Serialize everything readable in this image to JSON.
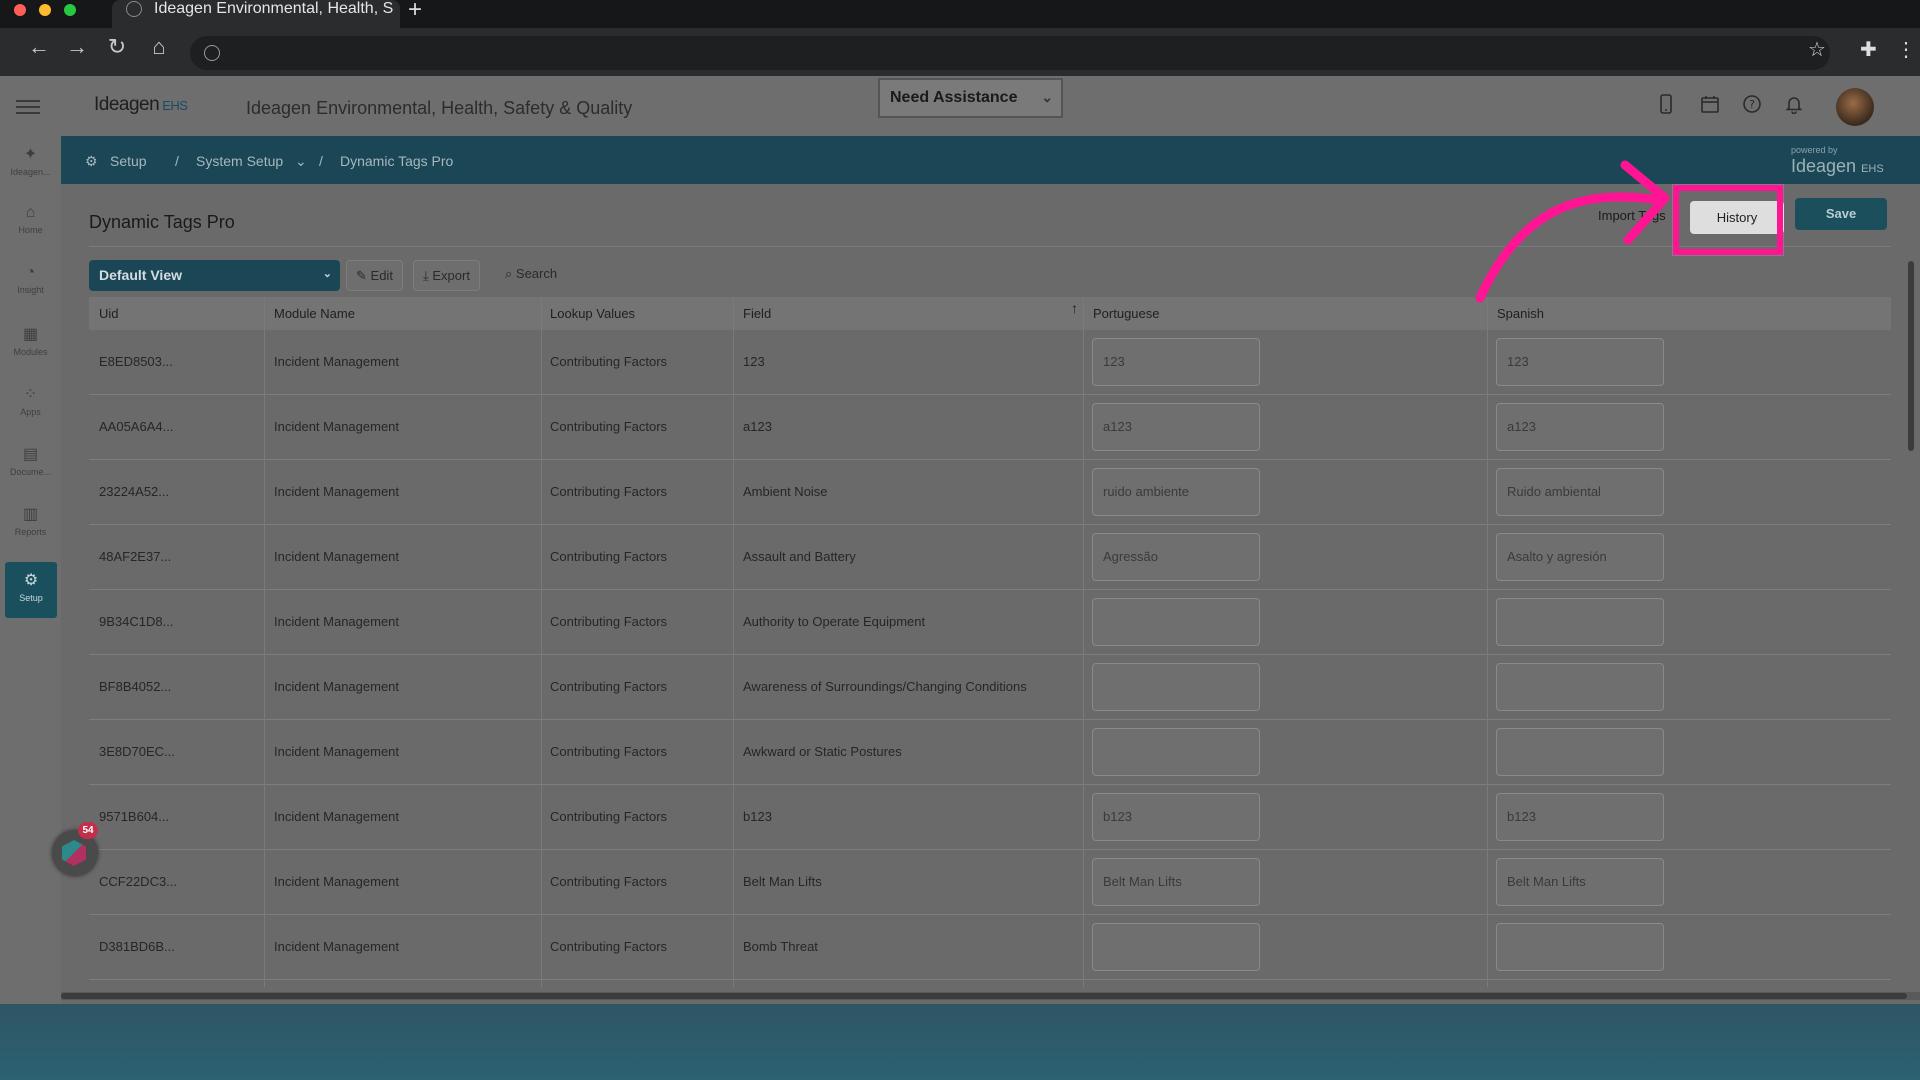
{
  "browser": {
    "tab_title": "Ideagen Environmental, Health, S",
    "new_tab": "+",
    "back": "←",
    "forward": "→",
    "reload": "↻",
    "home": "⌂",
    "star": "☆",
    "extensions": "✚",
    "menu": "⋮"
  },
  "header": {
    "logo": "Ideagen",
    "logo_suffix": "EHS",
    "app_title": "Ideagen Environmental, Health, Safety & Quality",
    "need_assistance": "Need Assistance",
    "icons": [
      "mobile-icon",
      "calendar-icon",
      "help-icon",
      "bell-icon"
    ]
  },
  "sidebar": {
    "items": [
      {
        "label": "Ideagen...",
        "icon": "ideagen-logo-icon"
      },
      {
        "label": "Home",
        "icon": "home-icon"
      },
      {
        "label": "Insight",
        "icon": "insight-icon"
      },
      {
        "label": "Modules",
        "icon": "modules-icon"
      },
      {
        "label": "Apps",
        "icon": "apps-icon"
      },
      {
        "label": "Docume...",
        "icon": "document-icon"
      },
      {
        "label": "Reports",
        "icon": "reports-icon"
      },
      {
        "label": "Setup",
        "icon": "gear-icon"
      }
    ]
  },
  "breadcrumb": {
    "setup": "Setup",
    "sep": "/",
    "system_setup": "System Setup",
    "current": "Dynamic Tags Pro",
    "powered_by": "powered by",
    "powered_logo": "Ideagen",
    "powered_suffix": "EHS"
  },
  "page": {
    "title": "Dynamic Tags Pro",
    "import_label": "Import Tags",
    "history_label": "History",
    "save_label": "Save"
  },
  "toolbar": {
    "view": "Default View",
    "edit": "Edit",
    "export": "Export",
    "search": "Search"
  },
  "table": {
    "columns": [
      "Uid",
      "Module Name",
      "Lookup Values",
      "Field",
      "Portuguese",
      "Spanish"
    ],
    "rows": [
      {
        "uid": "E8ED8503...",
        "module": "Incident Management",
        "lookup": "Contributing Factors",
        "field": "123",
        "pt": "123",
        "es": "123"
      },
      {
        "uid": "AA05A6A4...",
        "module": "Incident Management",
        "lookup": "Contributing Factors",
        "field": "a123",
        "pt": "a123",
        "es": "a123"
      },
      {
        "uid": "23224A52...",
        "module": "Incident Management",
        "lookup": "Contributing Factors",
        "field": "Ambient Noise",
        "pt": "ruido ambiente",
        "es": "Ruido ambiental"
      },
      {
        "uid": "48AF2E37...",
        "module": "Incident Management",
        "lookup": "Contributing Factors",
        "field": "Assault and Battery",
        "pt": "Agressão",
        "es": "Asalto y agresión"
      },
      {
        "uid": "9B34C1D8...",
        "module": "Incident Management",
        "lookup": "Contributing Factors",
        "field": "Authority to Operate Equipment",
        "pt": "",
        "es": ""
      },
      {
        "uid": "BF8B4052...",
        "module": "Incident Management",
        "lookup": "Contributing Factors",
        "field": "Awareness of Surroundings/Changing Conditions",
        "pt": "",
        "es": ""
      },
      {
        "uid": "3E8D70EC...",
        "module": "Incident Management",
        "lookup": "Contributing Factors",
        "field": "Awkward or Static Postures",
        "pt": "",
        "es": ""
      },
      {
        "uid": "9571B604...",
        "module": "Incident Management",
        "lookup": "Contributing Factors",
        "field": "b123",
        "pt": "b123",
        "es": "b123"
      },
      {
        "uid": "CCF22DC3...",
        "module": "Incident Management",
        "lookup": "Contributing Factors",
        "field": "Belt Man Lifts",
        "pt": "Belt Man Lifts",
        "es": "Belt Man Lifts"
      },
      {
        "uid": "D381BD6B...",
        "module": "Incident Management",
        "lookup": "Contributing Factors",
        "field": "Bomb Threat",
        "pt": "",
        "es": ""
      }
    ]
  },
  "chat": {
    "badge": "54"
  },
  "colors": {
    "highlight": "#ff1493",
    "brand_teal": "#1b4655"
  }
}
